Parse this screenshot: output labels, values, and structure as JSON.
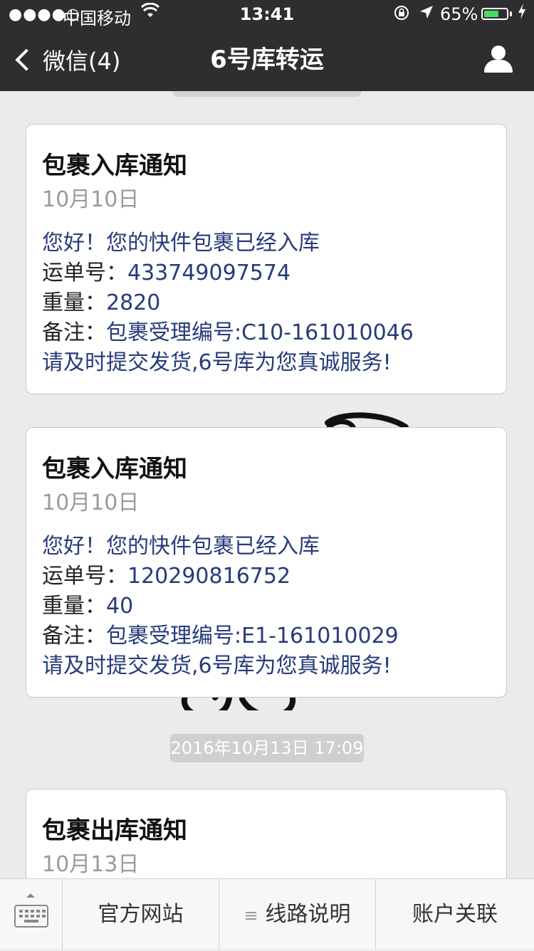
{
  "status_bar": {
    "signal": "●●●●○",
    "carrier": "中国移动",
    "time": "13:41",
    "battery_percent": "65%",
    "battery_level": 0.65,
    "battery_color": "#4cd964"
  },
  "nav": {
    "back_label": "微信(4)",
    "title": "6号库转运",
    "profile_icon": "person-icon"
  },
  "messages": [
    {
      "title": "包裹入库通知",
      "date": "10月10日",
      "line1": "您好！您的快件包裹已经入库",
      "waybill_label": "运单号：",
      "waybill_value": "433749097574",
      "weight_label": "重量：",
      "weight_value": "2820",
      "remark_label": "备注：",
      "remark_value": "包裹受理编号:C10-161010046",
      "closing": "请及时提交发货,6号库为您真诚服务!"
    },
    {
      "title": "包裹入库通知",
      "date": "10月10日",
      "line1": "您好！您的快件包裹已经入库",
      "waybill_label": "运单号：",
      "waybill_value": "120290816752",
      "weight_label": "重量：",
      "weight_value": "40",
      "remark_label": "备注：",
      "remark_value": "包裹受理编号:E1-161010029",
      "closing": "请及时提交发货,6号库为您真诚服务!"
    },
    {
      "title": "包裹出库通知",
      "date": "10月13日"
    }
  ],
  "timestamp_pill": "2016年10月13日 17:09",
  "menu": {
    "keyboard_icon": "keyboard-icon",
    "item1": "官方网站",
    "item2": "线路说明",
    "item3": "账户关联"
  }
}
